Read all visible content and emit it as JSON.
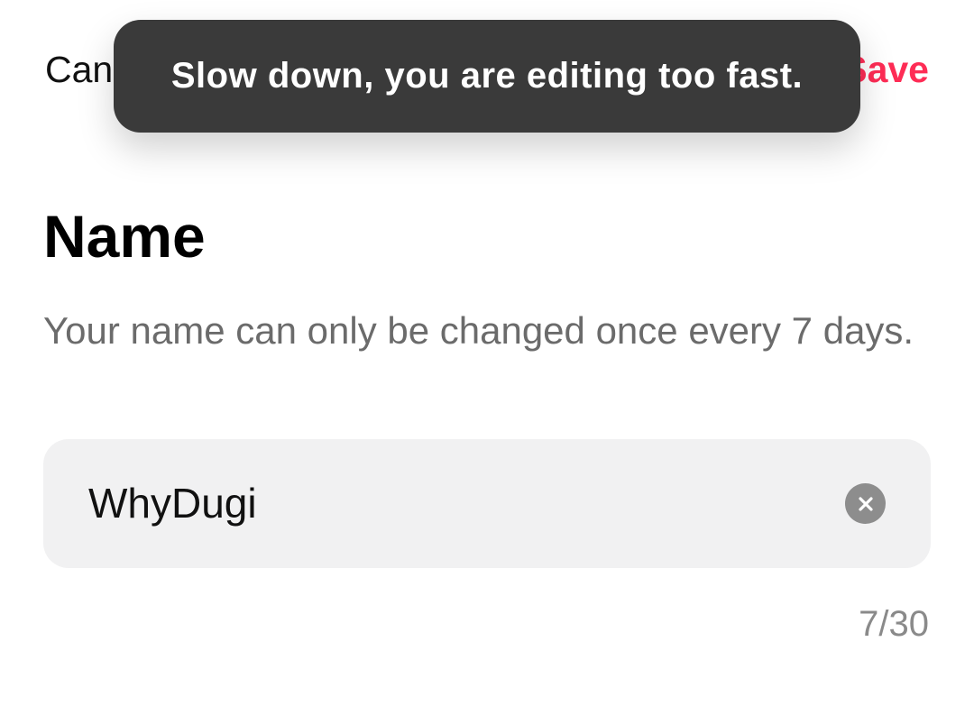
{
  "nav": {
    "cancel_label": "Cancel",
    "save_label": "Save",
    "save_color": "#fe2c55"
  },
  "toast": {
    "message": "Slow down, you are editing too fast."
  },
  "section": {
    "title": "Name",
    "description": "Your name can only be changed once every 7 days."
  },
  "name_field": {
    "value": "WhyDugi",
    "clear_icon": "clear-circle-x-icon"
  },
  "counter": {
    "text": "7/30",
    "current": 7,
    "max": 30
  }
}
